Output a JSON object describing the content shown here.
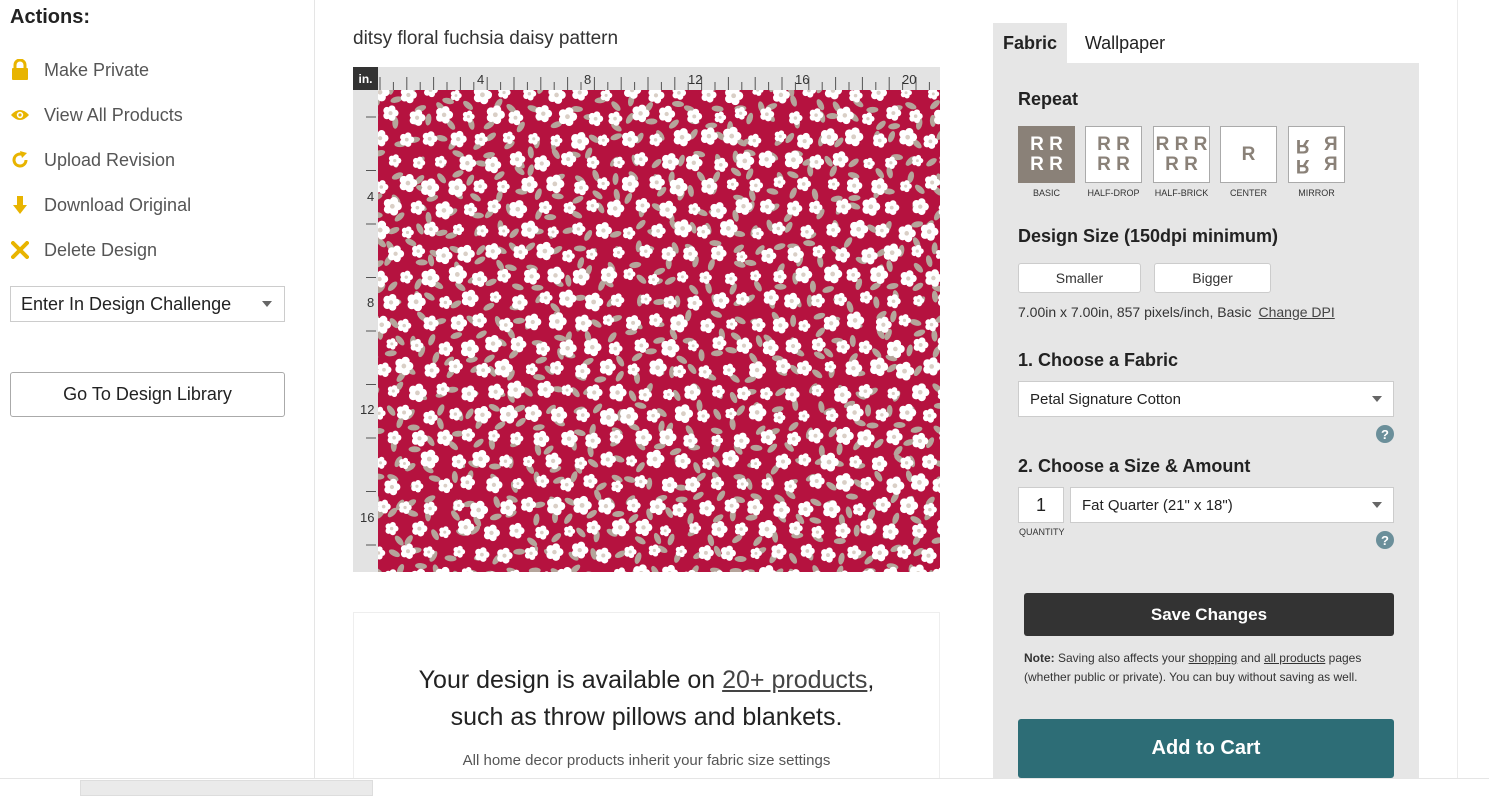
{
  "sidebar": {
    "title": "Actions:",
    "actions": [
      {
        "label": "Make Private",
        "icon": "lock-icon"
      },
      {
        "label": "View All Products",
        "icon": "eye-icon"
      },
      {
        "label": "Upload Revision",
        "icon": "refresh-icon"
      },
      {
        "label": "Download Original",
        "icon": "download-arrow-icon"
      },
      {
        "label": "Delete Design",
        "icon": "close-x-icon"
      }
    ],
    "challenge_select": "Enter In Design Challenge",
    "library_button": "Go To Design Library",
    "icon_color": "#e8b400"
  },
  "design": {
    "title": "ditsy floral fuchsia daisy pattern",
    "ruler_unit": "in.",
    "ruler_top": [
      "4",
      "8",
      "12",
      "16",
      "20"
    ],
    "ruler_left": [
      "4",
      "8",
      "12",
      "16"
    ],
    "pattern_colors": {
      "background": "#b5123f",
      "flower": "#ffffff",
      "leaf": "#b5a59b",
      "center": "#d9cfc6"
    }
  },
  "promo": {
    "line1_prefix": "Your design is available on ",
    "line1_link": "20+ products",
    "line1_suffix": ",",
    "line2": "such as throw pillows and blankets.",
    "sub": "All home decor products inherit your fabric size settings"
  },
  "panel": {
    "tabs": [
      "Fabric",
      "Wallpaper"
    ],
    "repeat_label": "Repeat",
    "repeat_options": [
      {
        "caption": "BASIC",
        "selected": true
      },
      {
        "caption": "HALF-DROP",
        "selected": false
      },
      {
        "caption": "HALF-BRICK",
        "selected": false
      },
      {
        "caption": "CENTER",
        "selected": false
      },
      {
        "caption": "MIRROR",
        "selected": false
      }
    ],
    "design_size_label": "Design Size (150dpi minimum)",
    "smaller_btn": "Smaller",
    "bigger_btn": "Bigger",
    "size_info": "7.00in x 7.00in, 857 pixels/inch, Basic",
    "change_dpi": "Change DPI",
    "choose_fabric_label": "1. Choose a Fabric",
    "fabric_value": "Petal Signature Cotton",
    "choose_size_label": "2. Choose a Size & Amount",
    "quantity": "1",
    "quantity_caption": "QUANTITY",
    "size_value": "Fat Quarter (21\" x 18\")",
    "save_btn": "Save Changes",
    "note_label": "Note:",
    "note_text1": " Saving also affects your ",
    "note_link1": "shopping",
    "note_text2": " and ",
    "note_link2": "all products",
    "note_text3": " pages (whether public or private). You can buy without saving as well.",
    "add_to_cart": "Add to Cart",
    "help_glyph": "?",
    "accent_color": "#2d6d76"
  }
}
